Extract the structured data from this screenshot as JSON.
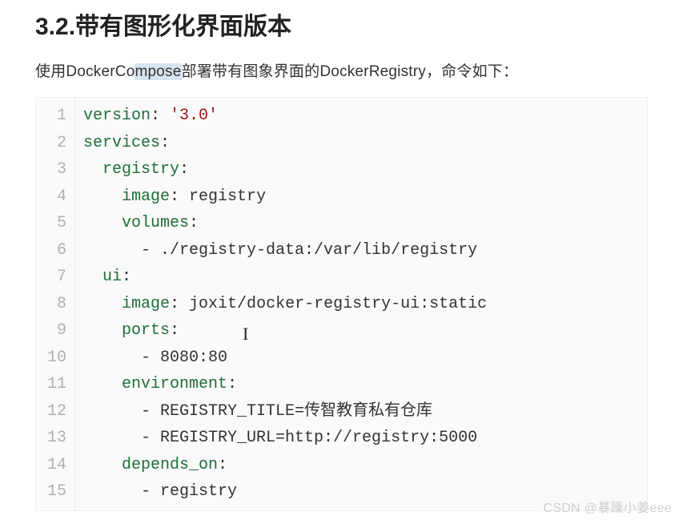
{
  "heading": "3.2.带有图形化界面版本",
  "intro_before": "使用DockerCo",
  "intro_selected": "mpose",
  "intro_after": "部署带有图象界面的DockerRegistry，命令如下：",
  "code": {
    "lines": [
      [
        {
          "t": "key",
          "v": "version"
        },
        {
          "t": "punc",
          "v": ":"
        },
        {
          "t": "plain",
          "v": " "
        },
        {
          "t": "str",
          "v": "'3.0'"
        }
      ],
      [
        {
          "t": "key",
          "v": "services"
        },
        {
          "t": "punc",
          "v": ":"
        }
      ],
      [
        {
          "t": "plain",
          "v": "  "
        },
        {
          "t": "key",
          "v": "registry"
        },
        {
          "t": "punc",
          "v": ":"
        }
      ],
      [
        {
          "t": "plain",
          "v": "    "
        },
        {
          "t": "key",
          "v": "image"
        },
        {
          "t": "punc",
          "v": ":"
        },
        {
          "t": "plain",
          "v": " registry"
        }
      ],
      [
        {
          "t": "plain",
          "v": "    "
        },
        {
          "t": "key",
          "v": "volumes"
        },
        {
          "t": "punc",
          "v": ":"
        }
      ],
      [
        {
          "t": "plain",
          "v": "      - ./registry-data:/var/lib/registry"
        }
      ],
      [
        {
          "t": "plain",
          "v": "  "
        },
        {
          "t": "key",
          "v": "ui"
        },
        {
          "t": "punc",
          "v": ":"
        }
      ],
      [
        {
          "t": "plain",
          "v": "    "
        },
        {
          "t": "key",
          "v": "image"
        },
        {
          "t": "punc",
          "v": ":"
        },
        {
          "t": "plain",
          "v": " joxit/docker-registry-ui:static"
        }
      ],
      [
        {
          "t": "plain",
          "v": "    "
        },
        {
          "t": "key",
          "v": "ports"
        },
        {
          "t": "punc",
          "v": ":"
        }
      ],
      [
        {
          "t": "plain",
          "v": "      - 8080:80"
        }
      ],
      [
        {
          "t": "plain",
          "v": "    "
        },
        {
          "t": "key",
          "v": "environment"
        },
        {
          "t": "punc",
          "v": ":"
        }
      ],
      [
        {
          "t": "plain",
          "v": "      - REGISTRY_TITLE=传智教育私有仓库"
        }
      ],
      [
        {
          "t": "plain",
          "v": "      - REGISTRY_URL=http://registry:5000"
        }
      ],
      [
        {
          "t": "plain",
          "v": "    "
        },
        {
          "t": "key",
          "v": "depends_on"
        },
        {
          "t": "punc",
          "v": ":"
        }
      ],
      [
        {
          "t": "plain",
          "v": "      - registry"
        }
      ]
    ]
  },
  "watermark": "CSDN @暴躁小姜eee"
}
